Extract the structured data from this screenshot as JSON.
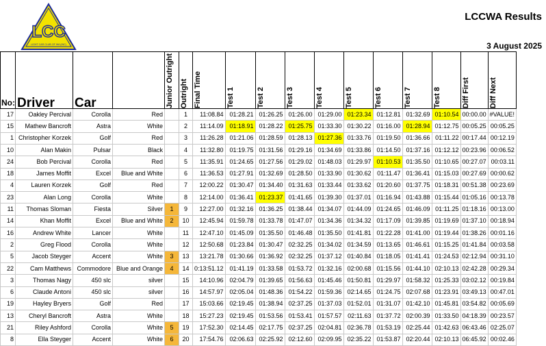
{
  "title": "LCCWA Results",
  "date": "3 August 2025",
  "logo": {
    "letters": "LCC",
    "caption": "LIGHT CAR CLUB OF WA (INC)"
  },
  "headers": {
    "no": "No:",
    "driver": "Driver",
    "car": "Car",
    "junior": "Junior Outright",
    "outright": "Outright",
    "final": "Final Time",
    "t1": "Test 1",
    "t2": "Test 2",
    "t3": "Test 3",
    "t4": "Test 4",
    "t5": "Test 5",
    "t6": "Test 6",
    "t7": "Test 7",
    "t8": "Test 8",
    "diff_first": "Diff First",
    "diff_next": "Diff Next"
  },
  "rows": [
    {
      "no": "17",
      "driver": "Oakley Percival",
      "car": "Corolla",
      "colour": "Red",
      "junior": "",
      "outright": "1",
      "final": "11:08.84",
      "t1": "01:28.21",
      "t2": "01:26.25",
      "t3": "01:26.00",
      "t4": "01:29.00",
      "t5": "01:23.34",
      "t6": "01:12.81",
      "t7": "01:32.69",
      "t8": "01:10.54",
      "df": "00:00.00",
      "dn": "#VALUE!"
    },
    {
      "no": "15",
      "driver": "Mathew Bancroft",
      "car": "Astra",
      "colour": "White",
      "junior": "",
      "outright": "2",
      "final": "11:14.09",
      "t1": "01:18.91",
      "t2": "01:28.22",
      "t3": "01:25.75",
      "t4": "01:33.30",
      "t5": "01:30.22",
      "t6": "01:16.00",
      "t7": "01:28.94",
      "t8": "01:12.75",
      "df": "00:05.25",
      "dn": "00:05.25"
    },
    {
      "no": "1",
      "driver": "Christopher Korzek",
      "car": "Golf",
      "colour": "Red",
      "junior": "",
      "outright": "3",
      "final": "11:26.28",
      "t1": "01:21.06",
      "t2": "01:28.59",
      "t3": "01:28.13",
      "t4": "01:27.36",
      "t5": "01:33.76",
      "t6": "01:19.50",
      "t7": "01:36.66",
      "t8": "01:11.22",
      "df": "00:17.44",
      "dn": "00:12.19"
    },
    {
      "no": "10",
      "driver": "Alan Makin",
      "car": "Pulsar",
      "colour": "Black",
      "junior": "",
      "outright": "4",
      "final": "11:32.80",
      "t1": "01:19.75",
      "t2": "01:31.56",
      "t3": "01:29.16",
      "t4": "01:34.69",
      "t5": "01:33.86",
      "t6": "01:14.50",
      "t7": "01:37.16",
      "t8": "01:12.12",
      "df": "00:23.96",
      "dn": "00:06.52"
    },
    {
      "no": "24",
      "driver": "Bob Percival",
      "car": "Corolla",
      "colour": "Red",
      "junior": "",
      "outright": "5",
      "final": "11:35.91",
      "t1": "01:24.65",
      "t2": "01:27.56",
      "t3": "01:29.02",
      "t4": "01:48.03",
      "t5": "01:29.97",
      "t6": "01:10.53",
      "t7": "01:35.50",
      "t8": "01:10.65",
      "df": "00:27.07",
      "dn": "00:03.11"
    },
    {
      "no": "18",
      "driver": "James Moffit",
      "car": "Excel",
      "colour": "Blue and White",
      "junior": "",
      "outright": "6",
      "final": "11:36.53",
      "t1": "01:27.91",
      "t2": "01:32.69",
      "t3": "01:28.50",
      "t4": "01:33.90",
      "t5": "01:30.62",
      "t6": "01:11.47",
      "t7": "01:36.41",
      "t8": "01:15.03",
      "df": "00:27.69",
      "dn": "00:00.62"
    },
    {
      "no": "4",
      "driver": "Lauren Korzek",
      "car": "Golf",
      "colour": "Red",
      "junior": "",
      "outright": "7",
      "final": "12:00.22",
      "t1": "01:30.47",
      "t2": "01:34.40",
      "t3": "01:31.63",
      "t4": "01:33.44",
      "t5": "01:33.62",
      "t6": "01:20.60",
      "t7": "01:37.75",
      "t8": "01:18.31",
      "df": "00:51.38",
      "dn": "00:23.69"
    },
    {
      "no": "23",
      "driver": "Alan Long",
      "car": "Corolla",
      "colour": "White",
      "junior": "",
      "outright": "8",
      "final": "12:14.00",
      "t1": "01:36.41",
      "t2": "01:23.37",
      "t3": "01:41.65",
      "t4": "01:39.30",
      "t5": "01:37.01",
      "t6": "01:16.94",
      "t7": "01:43.88",
      "t8": "01:15.44",
      "df": "01:05.16",
      "dn": "00:13.78"
    },
    {
      "no": "11",
      "driver": "Thomas Sloman",
      "car": "Fiesta",
      "colour": "Silver",
      "junior": "1",
      "outright": "9",
      "final": "12:27.00",
      "t1": "01:32.16",
      "t2": "01:36.25",
      "t3": "01:38.44",
      "t4": "01:34.07",
      "t5": "01:44.09",
      "t6": "01:24.65",
      "t7": "01:46.09",
      "t8": "01:11.25",
      "df": "01:18.16",
      "dn": "00:13.00"
    },
    {
      "no": "14",
      "driver": "Khan Moffit",
      "car": "Excel",
      "colour": "Blue and White",
      "junior": "2",
      "outright": "10",
      "final": "12:45.94",
      "t1": "01:59.78",
      "t2": "01:33.78",
      "t3": "01:47.07",
      "t4": "01:34.36",
      "t5": "01:34.32",
      "t6": "01:17.09",
      "t7": "01:39.85",
      "t8": "01:19.69",
      "df": "01:37.10",
      "dn": "00:18.94"
    },
    {
      "no": "16",
      "driver": "Andrew White",
      "car": "Lancer",
      "colour": "White",
      "junior": "",
      "outright": "11",
      "final": "12:47.10",
      "t1": "01:45.09",
      "t2": "01:35.50",
      "t3": "01:46.48",
      "t4": "01:35.50",
      "t5": "01:41.81",
      "t6": "01:22.28",
      "t7": "01:41.00",
      "t8": "01:19.44",
      "df": "01:38.26",
      "dn": "00:01.16"
    },
    {
      "no": "2",
      "driver": "Greg Flood",
      "car": "Corolla",
      "colour": "White",
      "junior": "",
      "outright": "12",
      "final": "12:50.68",
      "t1": "01:23.84",
      "t2": "01:30.47",
      "t3": "02:32.25",
      "t4": "01:34.02",
      "t5": "01:34.59",
      "t6": "01:13.65",
      "t7": "01:46.61",
      "t8": "01:15.25",
      "df": "01:41.84",
      "dn": "00:03.58"
    },
    {
      "no": "5",
      "driver": "Jacob Steyger",
      "car": "Accent",
      "colour": "White",
      "junior": "3",
      "outright": "13",
      "final": "13:21.78",
      "t1": "01:30.66",
      "t2": "01:36.92",
      "t3": "02:32.25",
      "t4": "01:37.12",
      "t5": "01:40.84",
      "t6": "01:18.05",
      "t7": "01:41.41",
      "t8": "01:24.53",
      "df": "02:12.94",
      "dn": "00:31.10"
    },
    {
      "no": "22",
      "driver": "Cam Matthews",
      "car": "Commodore",
      "colour": "Blue and Orange",
      "junior": "4",
      "outright": "14",
      "final": "0:13:51.12",
      "t1": "01:41.19",
      "t2": "01:33.58",
      "t3": "01:53.72",
      "t4": "01:32.16",
      "t5": "02:00.68",
      "t6": "01:15.56",
      "t7": "01:44.10",
      "t8": "02:10.13",
      "df": "02:42.28",
      "dn": "00:29.34"
    },
    {
      "no": "3",
      "driver": "Thomas Nagy",
      "car": "450 slc",
      "colour": "silver",
      "junior": "",
      "outright": "15",
      "final": "14:10.96",
      "t1": "02:04.79",
      "t2": "01:39.65",
      "t3": "01:56.63",
      "t4": "01:45.46",
      "t5": "01:50.81",
      "t6": "01:29.97",
      "t7": "01:58.32",
      "t8": "01:25.33",
      "df": "03:02.12",
      "dn": "00:19.84"
    },
    {
      "no": "6",
      "driver": "Claude Antoni",
      "car": "450 slc",
      "colour": "silver",
      "junior": "",
      "outright": "16",
      "final": "14:57.97",
      "t1": "02:05.04",
      "t2": "01:48.36",
      "t3": "01:54.22",
      "t4": "01:59.36",
      "t5": "02:14.65",
      "t6": "01:24.75",
      "t7": "02:07.68",
      "t8": "01:23.91",
      "df": "03:49.13",
      "dn": "00:47.01"
    },
    {
      "no": "19",
      "driver": "Hayley Bryers",
      "car": "Golf",
      "colour": "Red",
      "junior": "",
      "outright": "17",
      "final": "15:03.66",
      "t1": "02:19.45",
      "t2": "01:38.94",
      "t3": "02:37.25",
      "t4": "01:37.03",
      "t5": "01:52.01",
      "t6": "01:31.07",
      "t7": "01:42.10",
      "t8": "01:45.81",
      "df": "03:54.82",
      "dn": "00:05.69"
    },
    {
      "no": "13",
      "driver": "Cheryl Bancroft",
      "car": "Astra",
      "colour": "White",
      "junior": "",
      "outright": "18",
      "final": "15:27.23",
      "t1": "02:19.45",
      "t2": "01:53.56",
      "t3": "01:53.41",
      "t4": "01:57.57",
      "t5": "02:11.63",
      "t6": "01:37.72",
      "t7": "02:00.39",
      "t8": "01:33.50",
      "df": "04:18.39",
      "dn": "00:23.57"
    },
    {
      "no": "21",
      "driver": "Riley Ashford",
      "car": "Corolla",
      "colour": "White",
      "junior": "5",
      "outright": "19",
      "final": "17:52.30",
      "t1": "02:14.45",
      "t2": "02:17.75",
      "t3": "02:37.25",
      "t4": "02:04.81",
      "t5": "02:36.78",
      "t6": "01:53.19",
      "t7": "02:25.44",
      "t8": "01:42.63",
      "df": "06:43.46",
      "dn": "02:25.07"
    },
    {
      "no": "8",
      "driver": "Ella Steyger",
      "car": "Accent",
      "colour": "White",
      "junior": "6",
      "outright": "20",
      "final": "17:54.76",
      "t1": "02:06.63",
      "t2": "02:25.92",
      "t3": "02:12.60",
      "t4": "02:09.95",
      "t5": "02:35.22",
      "t6": "01:53.87",
      "t7": "02:20.44",
      "t8": "02:10.13",
      "df": "06:45.92",
      "dn": "00:02.46"
    }
  ],
  "highlights": [
    {
      "row": 0,
      "col": "t5"
    },
    {
      "row": 0,
      "col": "t8"
    },
    {
      "row": 1,
      "col": "t1"
    },
    {
      "row": 1,
      "col": "t3"
    },
    {
      "row": 1,
      "col": "t7"
    },
    {
      "row": 2,
      "col": "t4"
    },
    {
      "row": 4,
      "col": "t6"
    },
    {
      "row": 7,
      "col": "t2"
    }
  ],
  "colors": {
    "highlight": "#ffff00",
    "junior": "#f5b73a",
    "logo_yellow": "#f2e200",
    "logo_blue": "#1c2a9a"
  }
}
